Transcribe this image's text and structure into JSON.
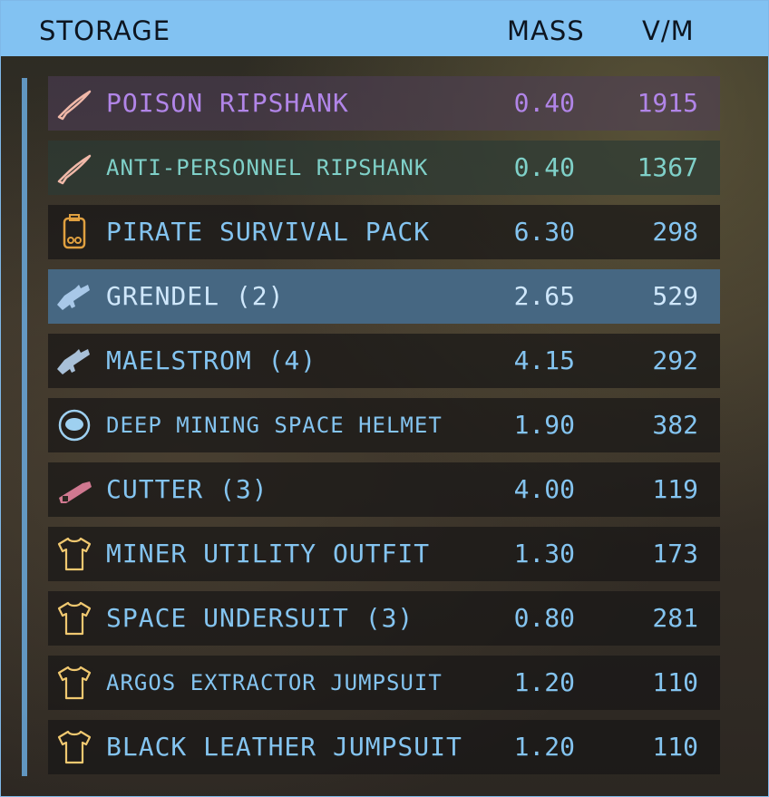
{
  "header": {
    "title": "STORAGE",
    "mass_label": "MASS",
    "vm_label": "V/M"
  },
  "colors": {
    "header_bg": "#82c2f2",
    "text_default": "#84c4f0",
    "tier_purple": "#b185e8",
    "tier_teal": "#7fd0c8",
    "selected_bg": "#466782"
  },
  "items": [
    {
      "name": "POISON RIPSHANK",
      "mass": "0.40",
      "vm": "1915",
      "icon": "knife-icon"
    },
    {
      "name": "ANTI-PERSONNEL RIPSHANK",
      "mass": "0.40",
      "vm": "1367",
      "icon": "knife-icon"
    },
    {
      "name": "PIRATE SURVIVAL PACK",
      "mass": "6.30",
      "vm": "298",
      "icon": "backpack-icon"
    },
    {
      "name": "GRENDEL (2)",
      "mass": "2.65",
      "vm": "529",
      "icon": "rifle-icon"
    },
    {
      "name": "MAELSTROM (4)",
      "mass": "4.15",
      "vm": "292",
      "icon": "rifle-icon"
    },
    {
      "name": "DEEP MINING SPACE HELMET",
      "mass": "1.90",
      "vm": "382",
      "icon": "helmet-icon"
    },
    {
      "name": "CUTTER (3)",
      "mass": "4.00",
      "vm": "119",
      "icon": "cutter-icon"
    },
    {
      "name": "MINER UTILITY OUTFIT",
      "mass": "1.30",
      "vm": "173",
      "icon": "shirt-icon"
    },
    {
      "name": "SPACE UNDERSUIT (3)",
      "mass": "0.80",
      "vm": "281",
      "icon": "shirt-icon"
    },
    {
      "name": "ARGOS EXTRACTOR JUMPSUIT",
      "mass": "1.20",
      "vm": "110",
      "icon": "shirt-icon"
    },
    {
      "name": "BLACK LEATHER JUMPSUIT",
      "mass": "1.20",
      "vm": "110",
      "icon": "shirt-icon"
    }
  ]
}
